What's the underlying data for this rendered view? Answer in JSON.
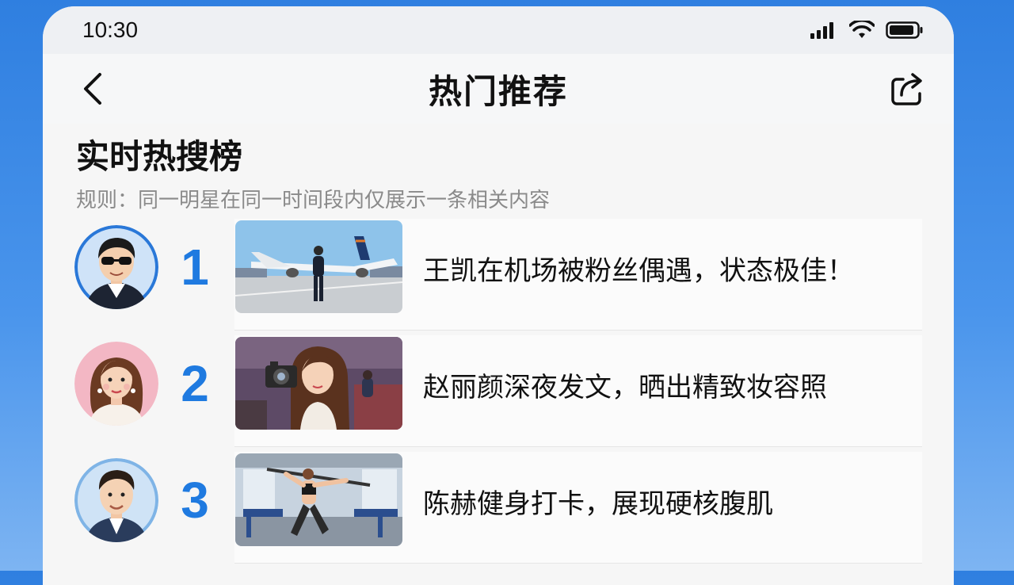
{
  "status_bar": {
    "time": "10:30"
  },
  "nav": {
    "title": "热门推荐"
  },
  "section": {
    "title": "实时热搜榜",
    "rule": "规则：同一明星在同一时间段内仅展示一条相关内容"
  },
  "items": [
    {
      "rank": "1",
      "headline": "王凯在机场被粉丝偶遇，状态极佳！"
    },
    {
      "rank": "2",
      "headline": "赵丽颜深夜发文，晒出精致妆容照"
    },
    {
      "rank": "3",
      "headline": "陈赫健身打卡，展现硬核腹肌"
    }
  ],
  "colors": {
    "accent": "#1f7ae0",
    "background": "#2f7fe0"
  }
}
